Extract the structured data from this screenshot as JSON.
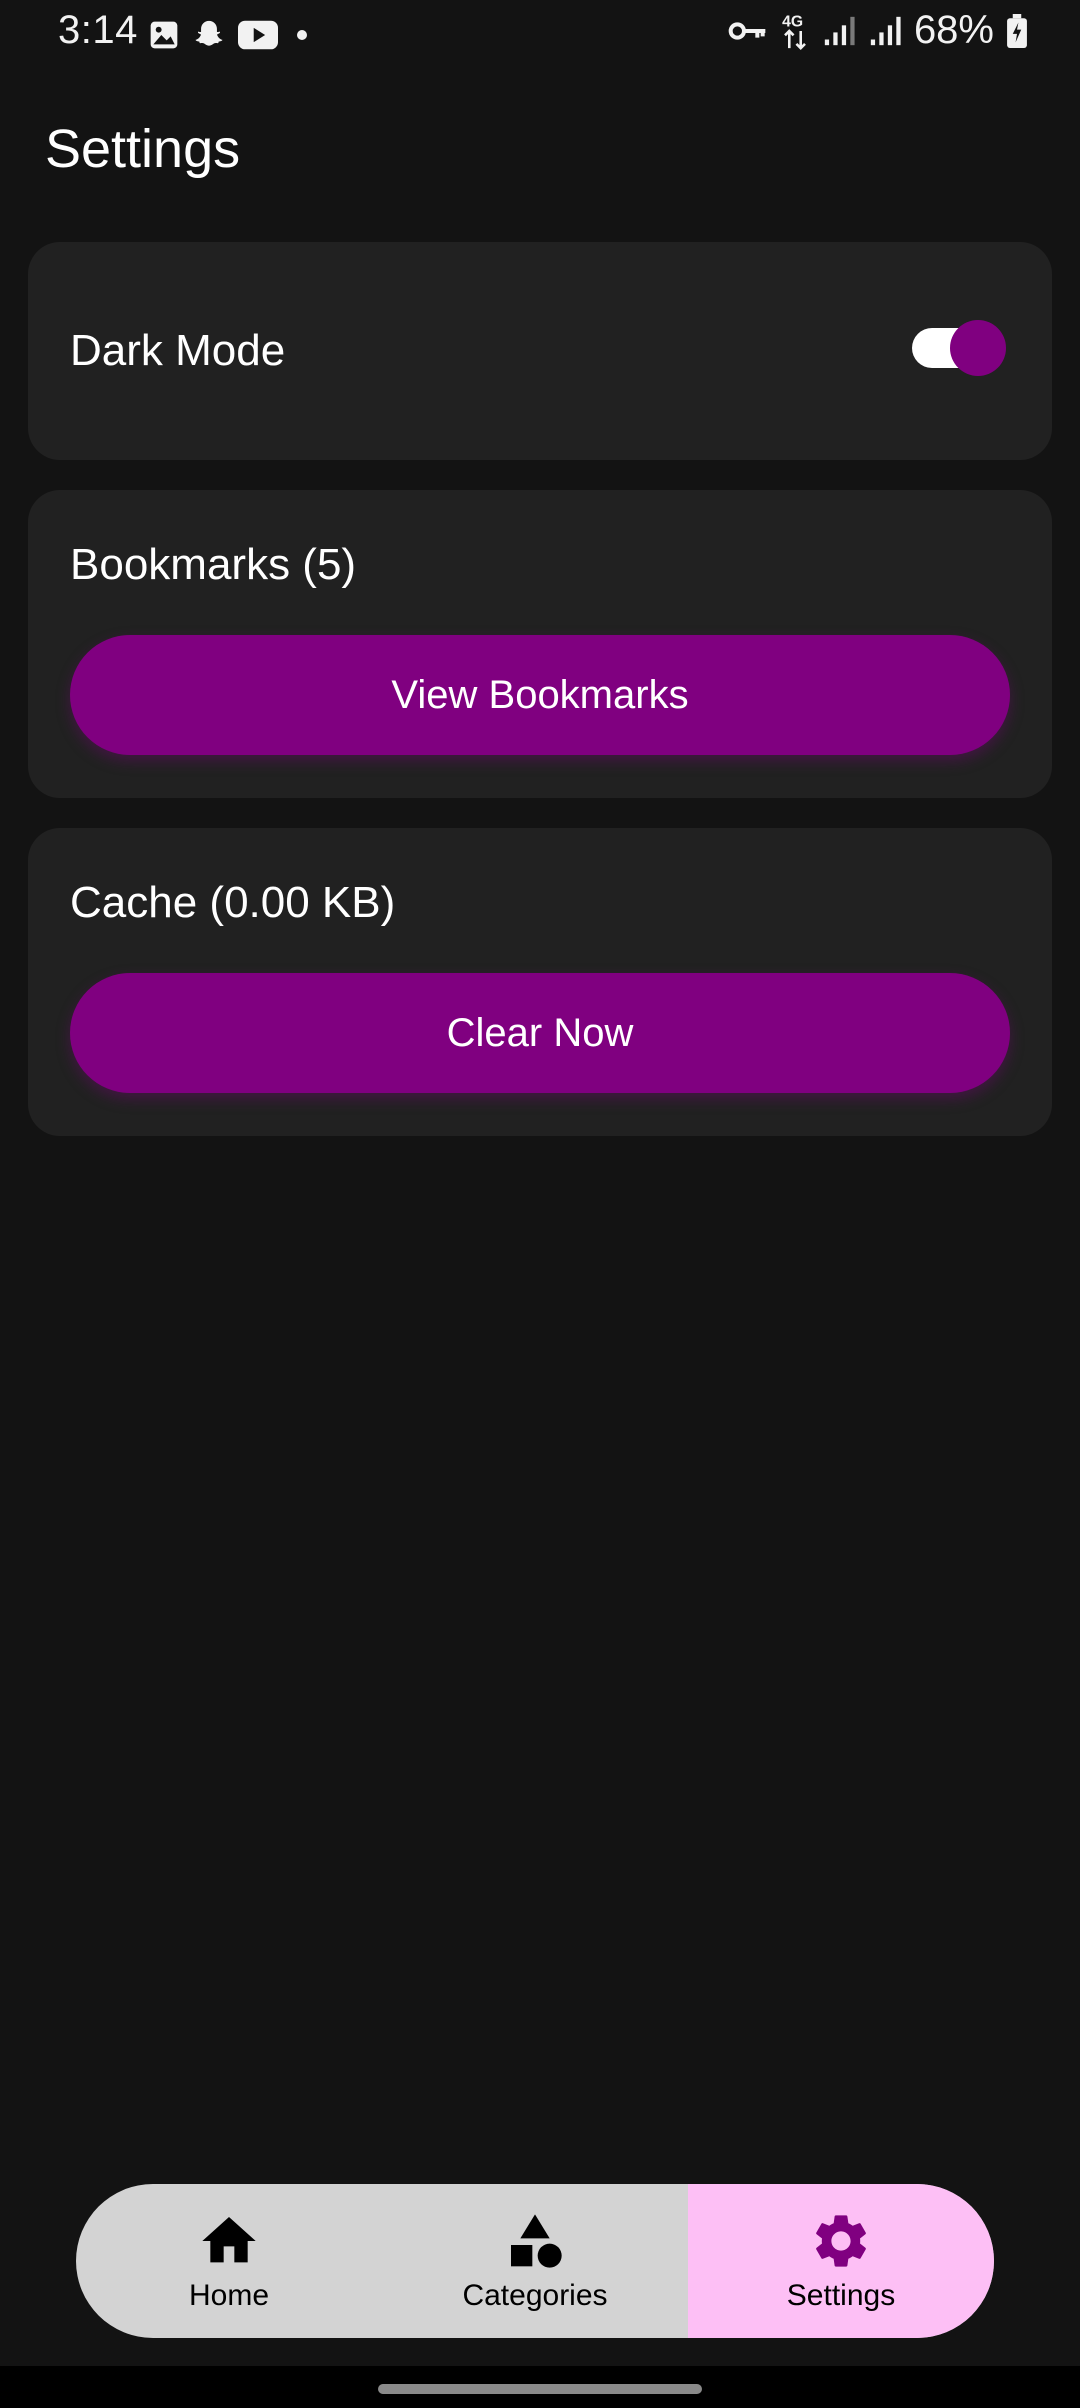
{
  "status_bar": {
    "time": "3:14",
    "battery_percent": "68%",
    "network_type": "4G",
    "left_icons": [
      "gallery-icon",
      "snapchat-icon",
      "youtube-icon",
      "dot-icon"
    ],
    "right_icons": [
      "vpn-key-icon",
      "network-4g-icon",
      "signal-icon",
      "signal-icon",
      "battery-charging-icon"
    ]
  },
  "header": {
    "title": "Settings"
  },
  "settings": {
    "dark_mode": {
      "label": "Dark Mode",
      "enabled": true
    },
    "bookmarks": {
      "label": "Bookmarks (5)",
      "button_label": "View Bookmarks"
    },
    "cache": {
      "label": "Cache (0.00 KB)",
      "button_label": "Clear Now"
    }
  },
  "bottom_nav": {
    "items": [
      {
        "label": "Home",
        "icon": "home-icon",
        "active": false
      },
      {
        "label": "Categories",
        "icon": "categories-icon",
        "active": false
      },
      {
        "label": "Settings",
        "icon": "gear-icon",
        "active": true
      }
    ]
  },
  "colors": {
    "background": "#131313",
    "card": "#212121",
    "accent": "#800080",
    "nav_background": "#d3d3d3",
    "nav_active": "#fdbff5"
  }
}
